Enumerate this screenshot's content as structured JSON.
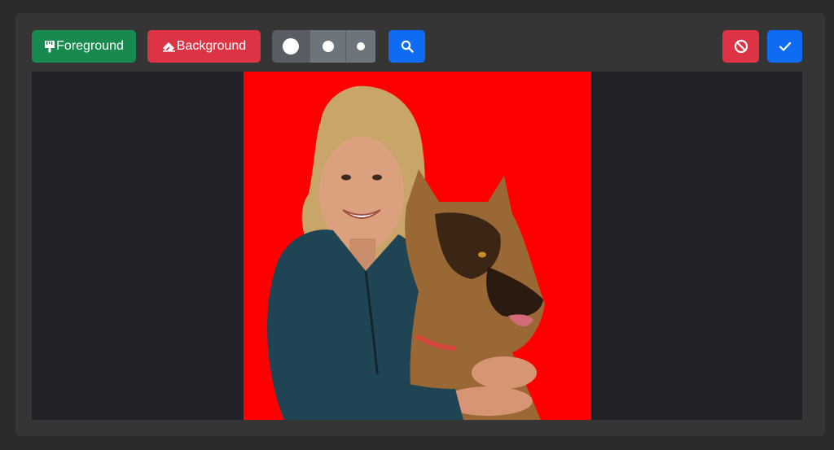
{
  "toolbar": {
    "foreground_label": "Foreground",
    "background_label": "Background",
    "brush_sizes": [
      "large",
      "medium",
      "small"
    ],
    "active_brush": "large"
  },
  "icons": {
    "foreground": "paintbrush-icon",
    "background": "eraser-icon",
    "search": "search-icon",
    "cancel": "ban-icon",
    "confirm": "check-icon"
  },
  "colors": {
    "foreground_button": "#198a4f",
    "background_button": "#dc3444",
    "primary_button": "#0f6cf2",
    "brush_group": "#6c757c",
    "canvas_bg": "#212328",
    "image_background": "#ff0000"
  },
  "canvas": {
    "subject": "Smiling woman with long blonde hair in a dark teal jacket hugging a German Shepherd dog, cut out over a red background"
  }
}
